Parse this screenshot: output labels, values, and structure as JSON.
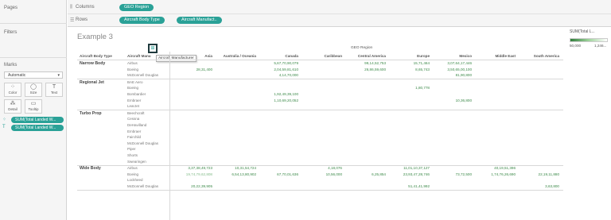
{
  "colors": {
    "pill": "#2aa197",
    "value_dark": "#3d8a4a",
    "value_light": "#86bd8c"
  },
  "sidebar": {
    "pages_label": "Pages",
    "filters_label": "Filters",
    "marks_label": "Marks",
    "mark_type": "Automatic",
    "buttons": [
      {
        "label": "Color",
        "icon": "color-icon"
      },
      {
        "label": "Size",
        "icon": "size-icon"
      },
      {
        "label": "Text",
        "icon": "text-icon"
      },
      {
        "label": "Detail",
        "icon": "detail-icon"
      },
      {
        "label": "Tooltip",
        "icon": "tooltip-icon"
      }
    ],
    "pills": [
      "SUM(Total Landed W...",
      "SUM(Total Landed W..."
    ]
  },
  "shelves": {
    "columns_label": "Columns",
    "rows_label": "Rows",
    "columns_pill": "GEO Region",
    "rows_pills": [
      "Aircraft Body Type",
      "Aircraft Manufact.."
    ]
  },
  "view": {
    "title": "Example 3",
    "geo_header": "GEO Region",
    "row_header_1": "Aircraft Body Type",
    "row_header_2": "Aircraft Manu",
    "tooltip": "Aircraft Manufacturer",
    "regions": [
      "Asia",
      "Australia / Oceania",
      "Canada",
      "Caribbean",
      "Central America",
      "Europe",
      "Mexico",
      "Middle East",
      "South America"
    ],
    "groups": [
      {
        "name": "Narrow Body",
        "rows": [
          {
            "mfr": "Airbus",
            "vals": [
              "",
              "",
              "5,67,70,90,079",
              "",
              "99,14,52,753",
              "15,71,464",
              "3,07,64,17,446",
              "",
              ""
            ]
          },
          {
            "mfr": "Boeing",
            "vals": [
              "28,31,400",
              "",
              "2,04,59,81,610",
              "",
              "26,86,59,600",
              "8,65,743",
              "3,50,65,00,100",
              "",
              ""
            ]
          },
          {
            "mfr": "McDonnell Douglas",
            "vals": [
              "",
              "",
              "4,14,70,000",
              "",
              "",
              "",
              "81,90,800",
              "",
              ""
            ]
          }
        ]
      },
      {
        "name": "Regional Jet",
        "rows": [
          {
            "mfr": "BAE Aero",
            "vals": [
              "",
              "",
              "",
              "",
              "",
              "",
              "",
              "",
              ""
            ]
          },
          {
            "mfr": "Boeing",
            "vals": [
              "",
              "",
              "",
              "",
              "",
              "1,80,778",
              "",
              "",
              ""
            ]
          },
          {
            "mfr": "Bombardier",
            "vals": [
              "",
              "",
              "1,92,49,39,100",
              "",
              "",
              "",
              "",
              "",
              ""
            ]
          },
          {
            "mfr": "Embraer",
            "vals": [
              "",
              "",
              "1,10,69,20,052",
              "",
              "",
              "",
              "10,36,800",
              "",
              ""
            ]
          },
          {
            "mfr": "LearJet",
            "vals": [
              "",
              "",
              "",
              "",
              "",
              "",
              "",
              "",
              ""
            ]
          }
        ]
      },
      {
        "name": "Turbo Prop",
        "rows": [
          {
            "mfr": "Beechcraft",
            "vals": [
              "",
              "",
              "",
              "",
              "",
              "",
              "",
              "",
              ""
            ]
          },
          {
            "mfr": "Cessna",
            "vals": [
              "",
              "",
              "",
              "",
              "",
              "",
              "",
              "",
              ""
            ]
          },
          {
            "mfr": "DeHavilland",
            "vals": [
              "",
              "",
              "",
              "",
              "",
              "",
              "",
              "",
              ""
            ]
          },
          {
            "mfr": "Embraer",
            "vals": [
              "",
              "",
              "",
              "",
              "",
              "",
              "",
              "",
              ""
            ]
          },
          {
            "mfr": "Fairchild",
            "vals": [
              "",
              "",
              "",
              "",
              "",
              "",
              "",
              "",
              ""
            ]
          },
          {
            "mfr": "McDonnell Douglas",
            "vals": [
              "",
              "",
              "",
              "",
              "",
              "",
              "",
              "",
              ""
            ]
          },
          {
            "mfr": "Piper",
            "vals": [
              "",
              "",
              "",
              "",
              "",
              "",
              "",
              "",
              ""
            ]
          },
          {
            "mfr": "Shorts",
            "vals": [
              "",
              "",
              "",
              "",
              "",
              "",
              "",
              "",
              ""
            ]
          },
          {
            "mfr": "Swearingen",
            "vals": [
              "",
              "",
              "",
              "",
              "",
              "",
              "",
              "",
              ""
            ]
          }
        ]
      },
      {
        "name": "Wide Body",
        "rows": [
          {
            "mfr": "Airbus",
            "vals": [
              "3,37,38,49,723",
              "10,31,54,724",
              "",
              "4,18,076",
              "",
              "11,01,10,37,127",
              "",
              "40,19,51,396",
              ""
            ]
          },
          {
            "mfr": "Boeing",
            "vals": [
              "19,74,79,62,808",
              "6,54,13,80,902",
              "67,70,01,636",
              "10,56,000",
              "6,25,854",
              "23,93,47,28,746",
              "73,72,500",
              "1,74,76,26,690",
              "22,19,11,880"
            ]
          },
          {
            "mfr": "Lockheed",
            "vals": [
              "",
              "",
              "",
              "",
              "",
              "",
              "",
              "",
              ""
            ]
          },
          {
            "mfr": "McDonnell Douglas",
            "vals": [
              "20,22,39,905",
              "",
              "",
              "",
              "",
              "51,41,41,992",
              "",
              "",
              "3,63,800"
            ]
          }
        ]
      }
    ]
  },
  "legend": {
    "title": "SUM(Total L...",
    "min": "50,000",
    "max": "1,246..."
  }
}
